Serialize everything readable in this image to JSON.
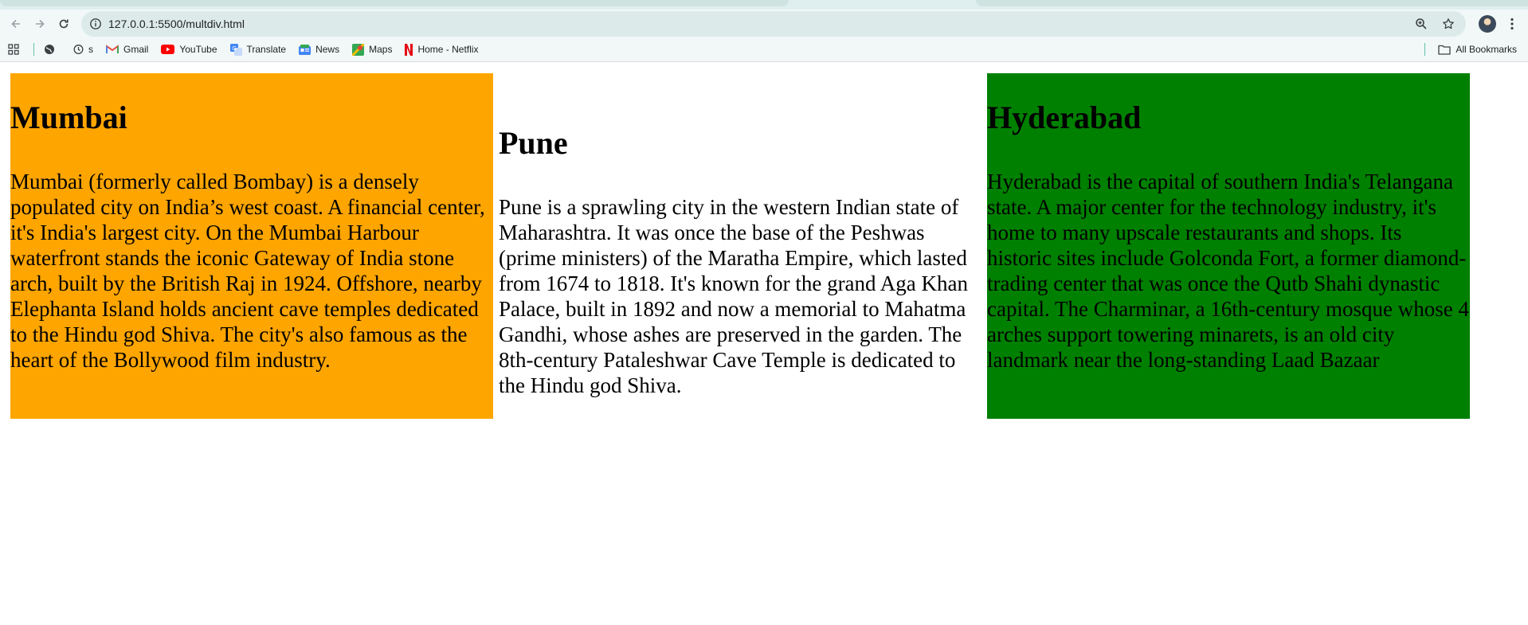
{
  "browser": {
    "url": "127.0.0.1:5500/multdiv.html",
    "bookmarks": [
      {
        "label": "",
        "icon": "globe-icon"
      },
      {
        "label": "s",
        "icon": "history-icon"
      },
      {
        "label": "Gmail",
        "icon": "gmail-icon"
      },
      {
        "label": "YouTube",
        "icon": "youtube-icon"
      },
      {
        "label": "Translate",
        "icon": "translate-icon"
      },
      {
        "label": "News",
        "icon": "news-icon"
      },
      {
        "label": "Maps",
        "icon": "maps-icon"
      },
      {
        "label": "Home - Netflix",
        "icon": "netflix-icon"
      }
    ],
    "all_bookmarks_label": "All Bookmarks"
  },
  "cities": [
    {
      "title": "Mumbai",
      "text": "Mumbai (formerly called Bombay) is a densely populated city on India’s west coast. A financial center, it's India's largest city. On the Mumbai Harbour waterfront stands the iconic Gateway of India stone arch, built by the British Raj in 1924. Offshore, nearby Elephanta Island holds ancient cave temples dedicated to the Hindu god Shiva. The city's also famous as the heart of the Bollywood film industry.",
      "color": "#ffa500"
    },
    {
      "title": "Pune",
      "text": "Pune is a sprawling city in the western Indian state of Maharashtra. It was once the base of the Peshwas (prime ministers) of the Maratha Empire, which lasted from 1674 to 1818. It's known for the grand Aga Khan Palace, built in 1892 and now a memorial to Mahatma Gandhi, whose ashes are preserved in the garden. The 8th-century Pataleshwar Cave Temple is dedicated to the Hindu god Shiva.",
      "color": "#ffffff"
    },
    {
      "title": "Hyderabad",
      "text": "Hyderabad is the capital of southern India's Telangana state. A major center for the technology industry, it's home to many upscale restaurants and shops. Its historic sites include Golconda Fort, a former diamond-trading center that was once the Qutb Shahi dynastic capital. The Charminar, a 16th-century mosque whose 4 arches support towering minarets, is an old city landmark near the long-standing Laad Bazaar",
      "color": "#008000"
    }
  ]
}
